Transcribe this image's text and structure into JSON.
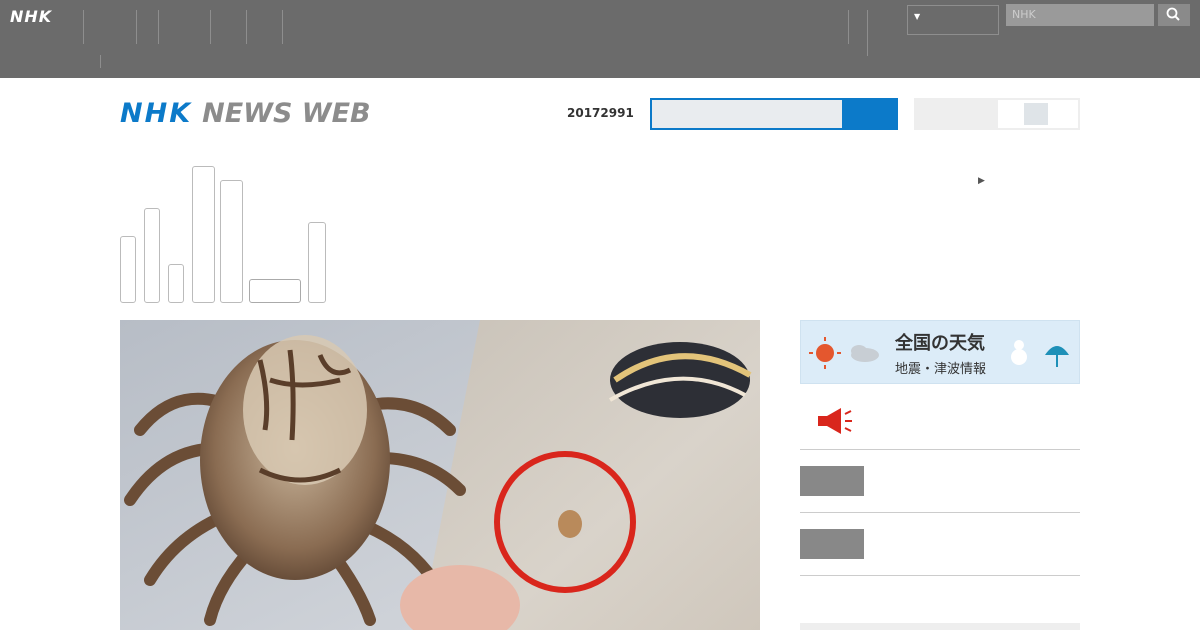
{
  "global_nav": {
    "logo": "NHK",
    "items": [
      {
        "label": "　　\n　　"
      },
      {
        "label": "　　　\n　　　"
      },
      {
        "label": "　　"
      },
      {
        "label": "　　　　\n　　　"
      },
      {
        "label": "　　　\n　　　"
      },
      {
        "label": "　　\n　　　　\n　　　"
      }
    ],
    "right_items": [
      {
        "label": "　　\n　　"
      },
      {
        "label": "　　　\n　　　"
      }
    ],
    "pref_select_value": "　　",
    "search_placeholder": "NHK"
  },
  "header": {
    "logo_nhk": "NHK",
    "logo_news": "NEWS WEB",
    "date": "20172991",
    "menu_label": "　　　　　",
    "top_link": "　　　　　　　　　　"
  },
  "category": {
    "selected_label": "　　　　"
  },
  "sidebar": {
    "weather_title": "全国の天気",
    "weather_sub": "地震・津波情報",
    "items": [
      {
        "label": "　　　　　　　　　",
        "icon": "megaphone-icon"
      },
      {
        "label": "　　　　　　　"
      },
      {
        "label": "　　　　　　　"
      }
    ]
  },
  "colors": {
    "brand_blue": "#0c7ac9",
    "link": "#0b6a9e",
    "topbar": "#6b6b6b",
    "alert_red": "#d9261c"
  }
}
